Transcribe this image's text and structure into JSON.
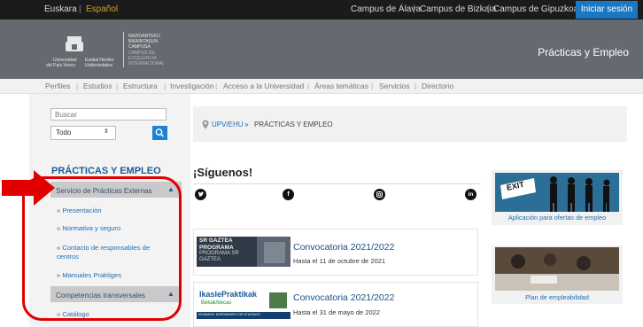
{
  "topbar": {
    "languages": [
      {
        "label": "Euskara",
        "active": false
      },
      {
        "label": "Español",
        "active": true
      }
    ],
    "campus_links": [
      "Campus de Álava",
      "Campus de Bizkaia",
      "Campus de Gipuzkoa"
    ],
    "login_label": "Iniciar sesión"
  },
  "header": {
    "site_title": "Prácticas y Empleo",
    "logo_text": {
      "left_line1": "Universidad",
      "left_line2": "del País Vasco",
      "mid_line1": "Euskal Herriko",
      "mid_line2": "Unibertsitatea",
      "right_line1": "NAZIOARTEKO",
      "right_line2": "BIKAINTASUN",
      "right_line3": "CAMPUSA",
      "right_line4": "CAMPUS DE",
      "right_line5": "EXCELENCIA",
      "right_line6": "INTERNACIONAL"
    }
  },
  "mainnav": {
    "items": [
      "Perfiles",
      "Estudios",
      "Estructura",
      "Investigación",
      "Acceso a la Universidad",
      "Áreas temáticas",
      "Servicios",
      "Directorio"
    ]
  },
  "search": {
    "placeholder": "Buscar",
    "scope_value": "Todo"
  },
  "breadcrumb": {
    "link": "UPV/EHU",
    "separator": "»",
    "current": "PRÁCTICAS Y EMPLEO"
  },
  "sidebar": {
    "title": "PRÁCTICAS Y EMPLEO",
    "sections": [
      {
        "label": "Servicio de Prácticas Externas"
      },
      {
        "label": "Competencias transversales"
      }
    ],
    "items": [
      {
        "label": "» Presentación"
      },
      {
        "label": "» Normativa y seguro"
      },
      {
        "label": "» Contacto de responsables de centros"
      },
      {
        "label": "» Manuales Praktiges"
      },
      {
        "label": "» Catálogo"
      }
    ]
  },
  "follow": {
    "title": "¡Síguenos!",
    "networks": [
      "twitter-icon",
      "facebook-icon",
      "instagram-icon",
      "linkedin-icon"
    ]
  },
  "news": [
    {
      "title": "Convocatoria 2021/2022",
      "date": "Hasta el 11 de octubre de 2021",
      "banner_line1": "SR GAZTEA",
      "banner_line2": "PROGRAMA",
      "banner_line3": "PROGRAMA SR",
      "banner_line4": "GAZTEA"
    },
    {
      "title": "Convocatoria 2021/2022",
      "date": "Hasta el 31 de mayo de 2022",
      "banner_line1": "IkaslePraktikak",
      "banner_line2": "Bekak/becas",
      "banner_line3": "ERASMUS+ INTERNSHIPS FOR STUDENTS"
    }
  ],
  "promos": [
    {
      "caption": "Aplicación para ofertas de empleo",
      "sign_text": "EXIT"
    },
    {
      "caption": "Plan de empleabilidad"
    }
  ],
  "colors": {
    "accent_blue": "#1d6fb5",
    "title_blue": "#1c5a99",
    "header_gray": "#666a70",
    "annotation_red": "#e00000",
    "language_active": "#c9a227"
  }
}
